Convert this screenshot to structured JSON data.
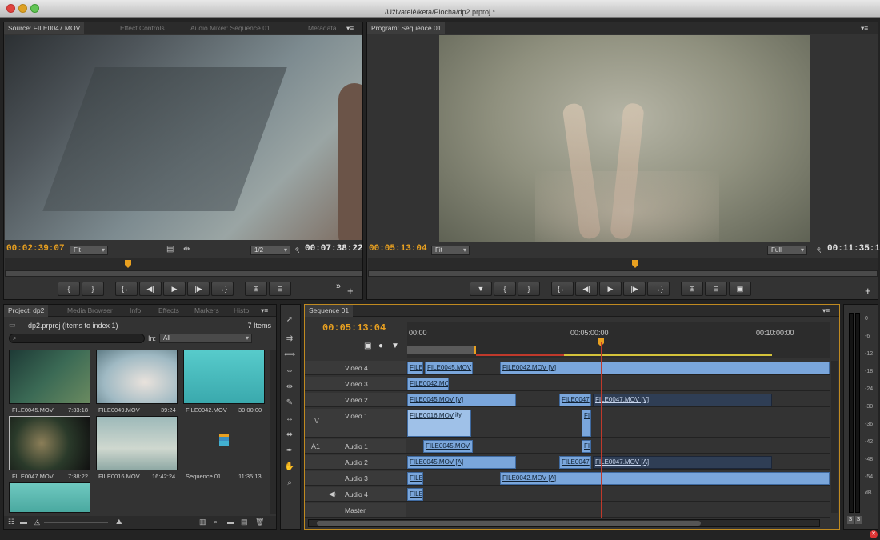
{
  "window": {
    "title": "/Uživatelé/keta/Plocha/dp2.prproj *"
  },
  "source": {
    "tabs": [
      "Source: FILE0047.MOV",
      "Effect Controls",
      "Audio Mixer: Sequence 01",
      "Metadata"
    ],
    "timecode": "00:02:39:07",
    "fit": "Fit",
    "resolution": "1/2",
    "duration": "00:07:38:22",
    "buttons": [
      "{",
      "}",
      "{←",
      "◀|",
      "▶",
      "|▶",
      "→}",
      "⊞",
      "⊟",
      "»"
    ]
  },
  "program": {
    "tabs": [
      "Program: Sequence 01"
    ],
    "timecode": "00:05:13:04",
    "fit": "Fit",
    "resolution": "Full",
    "duration": "00:11:35:13",
    "buttons": [
      "▼",
      "{",
      "}",
      "{←",
      "◀|",
      "▶",
      "|▶",
      "→}",
      "⊞",
      "⊟",
      "▣"
    ]
  },
  "project": {
    "tabs": [
      "Project: dp2",
      "Media Browser",
      "Info",
      "Effects",
      "Markers",
      "Histo"
    ],
    "name": "dp2.prproj (Items to index 1)",
    "count": "7 Items",
    "in_label": "In:",
    "in_value": "All",
    "items": [
      {
        "name": "FILE0045.MOV",
        "dur": "7:33:18",
        "color": "#3b5a4a"
      },
      {
        "name": "FILE0049.MOV",
        "dur": "39:24",
        "color": "#c9cfcf"
      },
      {
        "name": "FILE0042.MOV",
        "dur": "30:00:00",
        "color": "#4fc0c0"
      },
      {
        "name": "FILE0047.MOV",
        "dur": "7:38:22",
        "color": "#3e3a2a"
      },
      {
        "name": "FILE0016.MOV",
        "dur": "16:42:24",
        "color": "#8fb2b2"
      },
      {
        "name": "Sequence 01",
        "dur": "11:35:13",
        "color": "#333333"
      }
    ]
  },
  "timeline": {
    "tab": "Sequence 01",
    "timecode": "00:05:13:04",
    "ruler": [
      "00:00",
      "00:05:00:00",
      "00:10:00:00"
    ],
    "tracks": [
      {
        "name": "Video 4",
        "clips": [
          {
            "label": "FILE",
            "cls": ""
          },
          {
            "label": "FILE0045.MOV",
            "cls": ""
          },
          {
            "label": "FILE0042.MOV [V]",
            "cls": ""
          }
        ]
      },
      {
        "name": "Video 3",
        "clips": [
          {
            "label": "FILE0042.MC",
            "cls": ""
          }
        ]
      },
      {
        "name": "Video 2",
        "clips": [
          {
            "label": "FILE0045.MOV [V]",
            "cls": ""
          },
          {
            "label": "FILE0047",
            "cls": ""
          },
          {
            "label": "FILE0047.MOV [V]",
            "cls": "dark"
          }
        ]
      },
      {
        "name": "Video 1",
        "clips": [
          {
            "label": "FILE0016.MOV",
            "cls": "light"
          },
          {
            "label": "FIL",
            "cls": ""
          }
        ]
      },
      {
        "name": "Audio 1",
        "clips": [
          {
            "label": "FILE0045.MOV",
            "cls": ""
          },
          {
            "label": "FIL",
            "cls": ""
          }
        ]
      },
      {
        "name": "Audio 2",
        "clips": [
          {
            "label": "FILE0045.MOV [A]",
            "cls": ""
          },
          {
            "label": "FILE0047",
            "cls": ""
          },
          {
            "label": "FILE0047.MOV [A]",
            "cls": "dark"
          }
        ]
      },
      {
        "name": "Audio 3",
        "clips": [
          {
            "label": "FILE",
            "cls": ""
          },
          {
            "label": "FILE0042.MOV [A]",
            "cls": ""
          }
        ]
      },
      {
        "name": "Audio 4",
        "clips": [
          {
            "label": "FILE",
            "cls": ""
          }
        ]
      },
      {
        "name": "Master",
        "clips": []
      }
    ],
    "v_label": "V",
    "a_label": "A1",
    "opacity_label": "ity"
  },
  "meter": {
    "labels": [
      "0",
      "-6",
      "-12",
      "-18",
      "-24",
      "-30",
      "-36",
      "-42",
      "-48",
      "-54",
      "dB"
    ],
    "solo": [
      "S",
      "S"
    ]
  }
}
